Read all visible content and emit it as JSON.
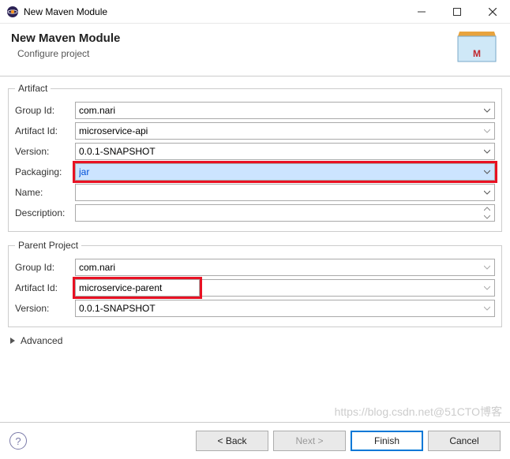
{
  "window": {
    "title": "New Maven Module"
  },
  "header": {
    "title": "New Maven Module",
    "subtitle": "Configure project"
  },
  "artifact": {
    "legend": "Artifact",
    "labels": {
      "groupId": "Group Id:",
      "artifactId": "Artifact Id:",
      "version": "Version:",
      "packaging": "Packaging:",
      "name": "Name:",
      "description": "Description:"
    },
    "groupId": "com.nari",
    "artifactId": "microservice-api",
    "version": "0.0.1-SNAPSHOT",
    "packaging": "jar",
    "name": "",
    "description": ""
  },
  "parent": {
    "legend": "Parent Project",
    "labels": {
      "groupId": "Group Id:",
      "artifactId": "Artifact Id:",
      "version": "Version:"
    },
    "groupId": "com.nari",
    "artifactId": "microservice-parent",
    "version": "0.0.1-SNAPSHOT"
  },
  "advanced": "Advanced",
  "buttons": {
    "back": "< Back",
    "next": "Next >",
    "finish": "Finish",
    "cancel": "Cancel"
  },
  "watermark": "https://blog.csdn.net@51CTO博客"
}
